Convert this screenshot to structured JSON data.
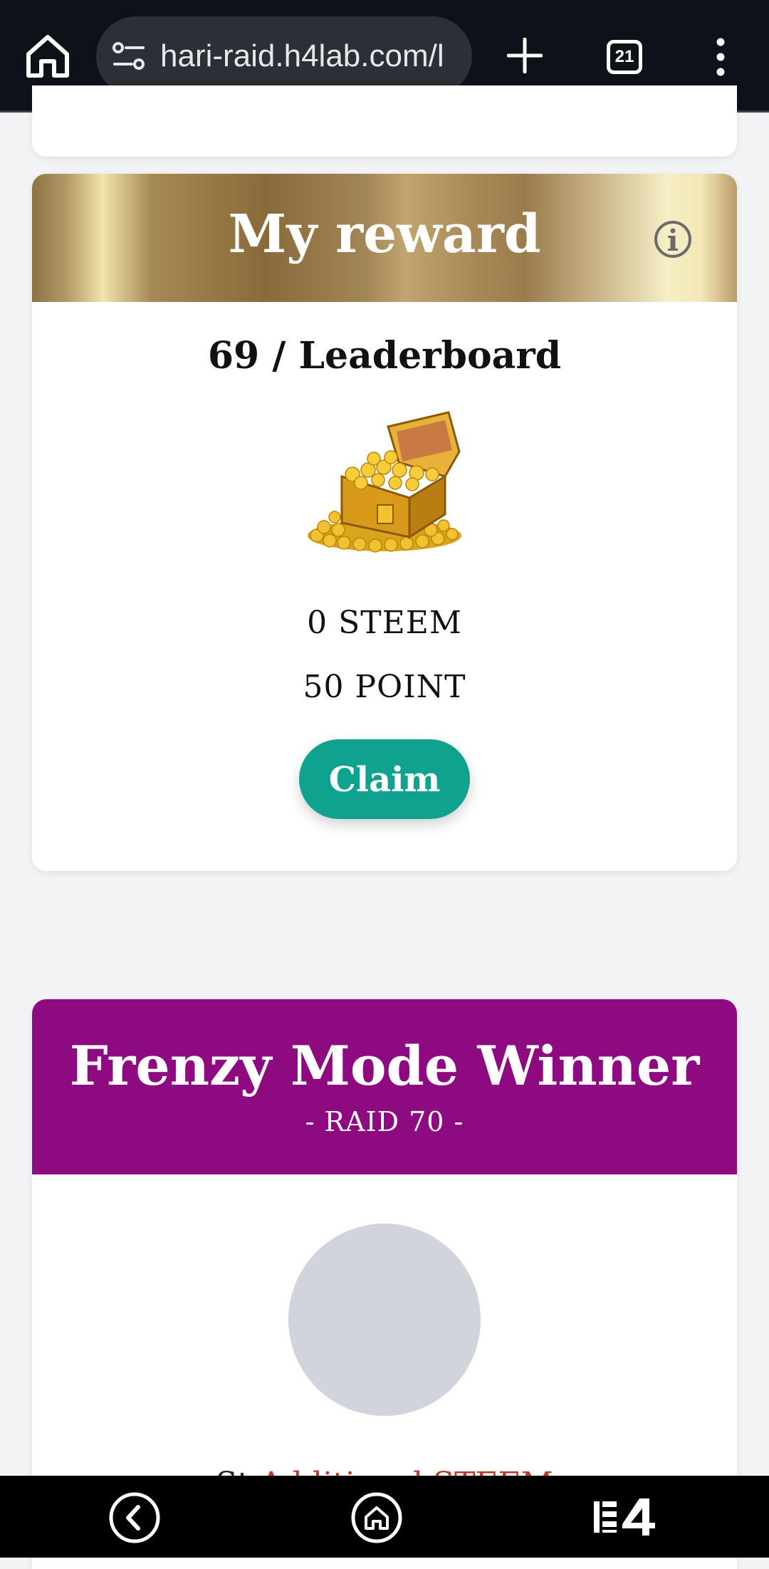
{
  "browser": {
    "url": "hari-raid.h4lab.com/l",
    "tab_count": "21"
  },
  "reward": {
    "title": "My reward",
    "rank": "69 / Leaderboard",
    "steem": "0 STEEM",
    "point": "50 POINT",
    "claim_label": "Claim"
  },
  "frenzy": {
    "title": "Frenzy Mode Winner",
    "subtitle": "- RAID 70 -",
    "partial_text_left": "St",
    "partial_text_right": "Additional STEEM"
  },
  "colors": {
    "reward_header_gold": "#a08555",
    "claim_button": "#0fa28e",
    "frenzy_header": "#8e0a81",
    "avatar_placeholder": "#d1d4da"
  },
  "icons": [
    "home-icon",
    "site-settings-icon",
    "plus-icon",
    "tab-switcher-icon",
    "more-menu-icon",
    "info-icon",
    "treasure-chest-icon",
    "back-icon",
    "home-nav-icon",
    "h4-app-icon"
  ]
}
